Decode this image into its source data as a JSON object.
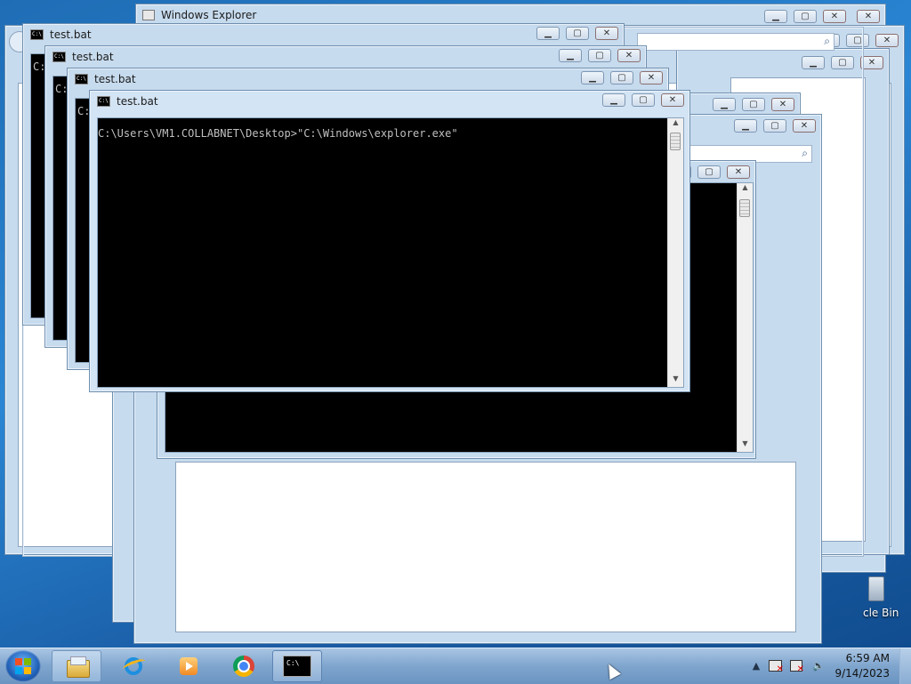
{
  "desktop": {
    "recycle_bin_label": "cle Bin"
  },
  "windows": {
    "explorer_title": "Windows Explorer",
    "cmd_title": "test.bat",
    "cmd_prompt_line": "C:\\Users\\VM1.COLLABNET\\Desktop>\"C:\\Windows\\explorer.exe\"",
    "cmd_partial": "C:"
  },
  "taskbar": {
    "pinned": [
      {
        "icon": "windows-explorer-icon"
      },
      {
        "icon": "internet-explorer-icon"
      },
      {
        "icon": "media-player-icon"
      },
      {
        "icon": "chrome-icon"
      },
      {
        "icon": "command-prompt-icon",
        "label": "C:\\"
      }
    ],
    "tray_icons": [
      "show-hidden-icons-chevron",
      "action-center-warning-icon",
      "network-icon",
      "volume-muted-icon"
    ],
    "clock_time": "6:59 AM",
    "clock_date": "9/14/2023"
  },
  "colors": {
    "window_frame": "#c7dbee",
    "console_bg": "#000000",
    "console_fg": "#c0c0c0",
    "taskbar": "#7fa5cd"
  }
}
